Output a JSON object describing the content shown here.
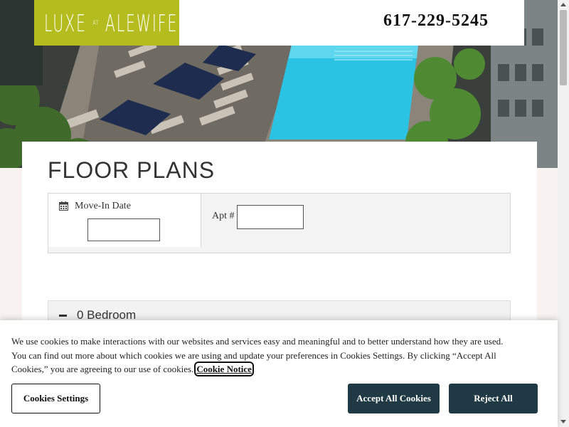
{
  "header": {
    "logo": {
      "word1": "LUXE",
      "at": "AT",
      "word2": "ALEWIFE"
    },
    "phone": "617-229-5245"
  },
  "hero": {
    "image_alt": "rooftop-pool"
  },
  "main": {
    "title": "FLOOR PLANS",
    "filters": {
      "move_in_label": "Move-In Date",
      "move_in_value": "",
      "apt_label": "Apt #",
      "apt_value": ""
    },
    "accordion": {
      "label": "0 Bedroom",
      "icon": "minus-icon"
    }
  },
  "cookie_banner": {
    "text": "We use cookies to make interactions with our websites and services easy and meaningful and to better understand how they are used. You can find out more about which cookies we are using and update your preferences in Cookies Settings. By clicking “Accept All Cookies,” you are agreeing to our use of cookies.",
    "link": "Cookie Notice",
    "settings_button": "Cookies Settings",
    "accept_button": "Accept All Cookies",
    "reject_button": "Reject All"
  },
  "colors": {
    "brand_green": "#b5bd1e",
    "button_dark": "#1f3a44",
    "pool": "#28c4e6"
  }
}
